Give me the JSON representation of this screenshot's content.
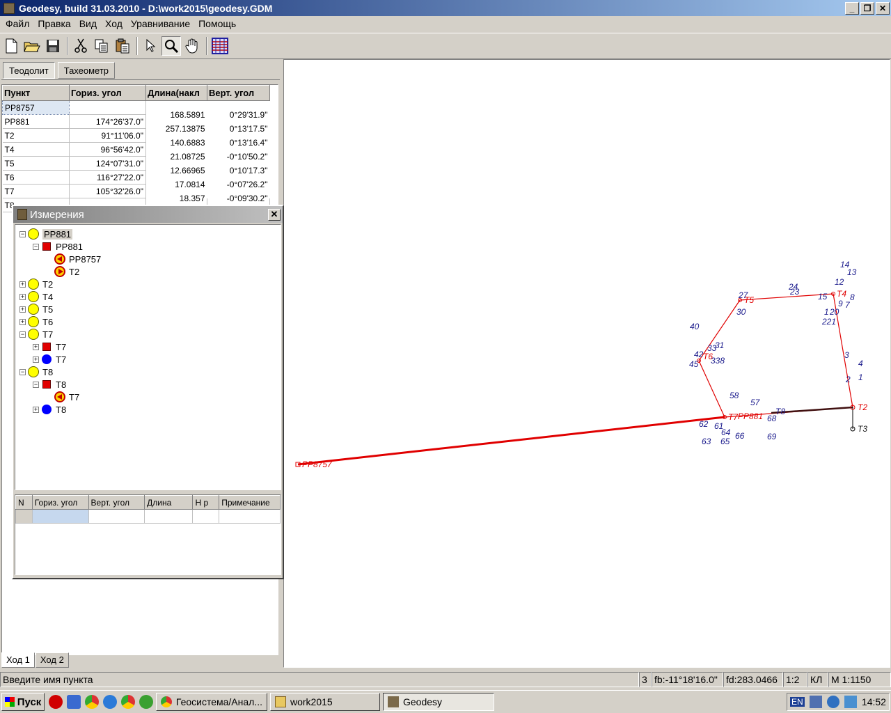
{
  "window": {
    "title": "Geodesy, build 31.03.2010 - D:\\work2015\\geodesy.GDM",
    "minimize_label": "_",
    "restore_label": "❐",
    "close_label": "✕"
  },
  "menu": {
    "items": [
      "Файл",
      "Правка",
      "Вид",
      "Ход",
      "Уравнивание",
      "Помощь"
    ]
  },
  "toolbar": {
    "icons": [
      "new-file-icon",
      "open-folder-icon",
      "save-icon",
      "cut-icon",
      "copy-icon",
      "paste-icon",
      "pointer-icon",
      "zoom-icon",
      "pan-hand-icon",
      "grid-icon"
    ]
  },
  "mode_tabs": [
    "Теодолит",
    "Тахеометр"
  ],
  "points_grid": {
    "columns": [
      "Пункт",
      "Гориз. угол",
      "Длина(накл",
      "Верт. угол"
    ],
    "rows": [
      {
        "point": "PP8757",
        "hangle": "",
        "length": "168.5891",
        "vangle": "0°29'31.9\""
      },
      {
        "point": "PP881",
        "hangle": "174°26'37.0\"",
        "length": "257.13875",
        "vangle": "0°13'17.5\""
      },
      {
        "point": "T2",
        "hangle": "91°11'06.0\"",
        "length": "140.6883",
        "vangle": "0°13'16.4\""
      },
      {
        "point": "T4",
        "hangle": "96°56'42.0\"",
        "length": "21.08725",
        "vangle": "-0°10'50.2\""
      },
      {
        "point": "T5",
        "hangle": "124°07'31.0\"",
        "length": "12.66965",
        "vangle": "0°10'17.3\""
      },
      {
        "point": "T6",
        "hangle": "116°27'22.0\"",
        "length": "17.0814",
        "vangle": "-0°07'26.2\""
      },
      {
        "point": "T7",
        "hangle": "105°32'26.0\"",
        "length": "18.357",
        "vangle": "-0°09'30.2\""
      },
      {
        "point": "T8",
        "hangle": "",
        "length": "",
        "vangle": ""
      }
    ]
  },
  "bottom_tabs": [
    "Ход 1",
    "Ход 2"
  ],
  "measurements_window": {
    "title": "Измерения",
    "close_label": "✕",
    "tree": [
      {
        "label": "PP881",
        "icon": "yellow-circle",
        "level": 0,
        "expander": "minus"
      },
      {
        "label": "PP881",
        "icon": "red-square",
        "level": 1,
        "expander": "minus"
      },
      {
        "label": "PP8757",
        "icon": "arrow-left",
        "level": 2,
        "expander": ""
      },
      {
        "label": "T2",
        "icon": "arrow-right",
        "level": 2,
        "expander": ""
      },
      {
        "label": "T2",
        "icon": "yellow-circle",
        "level": 0,
        "expander": "plus"
      },
      {
        "label": "T4",
        "icon": "yellow-circle",
        "level": 0,
        "expander": "plus"
      },
      {
        "label": "T5",
        "icon": "yellow-circle",
        "level": 0,
        "expander": "plus"
      },
      {
        "label": "T6",
        "icon": "yellow-circle",
        "level": 0,
        "expander": "plus"
      },
      {
        "label": "T7",
        "icon": "yellow-circle",
        "level": 0,
        "expander": "minus"
      },
      {
        "label": "T7",
        "icon": "red-square",
        "level": 1,
        "expander": "plus"
      },
      {
        "label": "T7",
        "icon": "blue-circle",
        "level": 1,
        "expander": "plus"
      },
      {
        "label": "T8",
        "icon": "yellow-circle",
        "level": 0,
        "expander": "minus"
      },
      {
        "label": "T8",
        "icon": "red-square",
        "level": 1,
        "expander": "minus"
      },
      {
        "label": "T7",
        "icon": "arrow-left",
        "level": 2,
        "expander": ""
      },
      {
        "label": "T8",
        "icon": "blue-circle",
        "level": 1,
        "expander": "plus"
      }
    ],
    "grid_columns": [
      "N",
      "Гориз. угол",
      "Верт. угол",
      "Длина",
      "H p",
      "Примечание"
    ]
  },
  "map": {
    "traverse_labels": [
      "PP8757",
      "PP881",
      "T2",
      "T3",
      "T4",
      "T5",
      "T6",
      "T7",
      "T8"
    ],
    "detail_labels": [
      "14",
      "13",
      "12",
      "8",
      "9",
      "7",
      "1",
      "20",
      "221",
      "15",
      "24",
      "23",
      "27",
      "30",
      "40",
      "31",
      "33",
      "338",
      "42",
      "45",
      "3",
      "4",
      "2",
      "1",
      "57",
      "58",
      "68",
      "62",
      "61",
      "64",
      "63",
      "65",
      "66",
      "69"
    ],
    "colors": {
      "traverse": "#e00000",
      "labels_red": "#e00000",
      "labels_blue": "#1a1a8c",
      "fixed_line": "#000000"
    }
  },
  "status": {
    "hint": "Введите имя пункта",
    "count": "3",
    "fb": "fb:-11°18'16.0\"",
    "fd": "fd:283.0466",
    "ratio": "1:2",
    "kl": "КЛ",
    "scale": "М 1:1150"
  },
  "taskbar": {
    "start_label": "Пуск",
    "tasks": [
      "Геосистема/Анал...",
      "work2015",
      "Geodesy"
    ],
    "lang": "EN",
    "clock": "14:52"
  }
}
